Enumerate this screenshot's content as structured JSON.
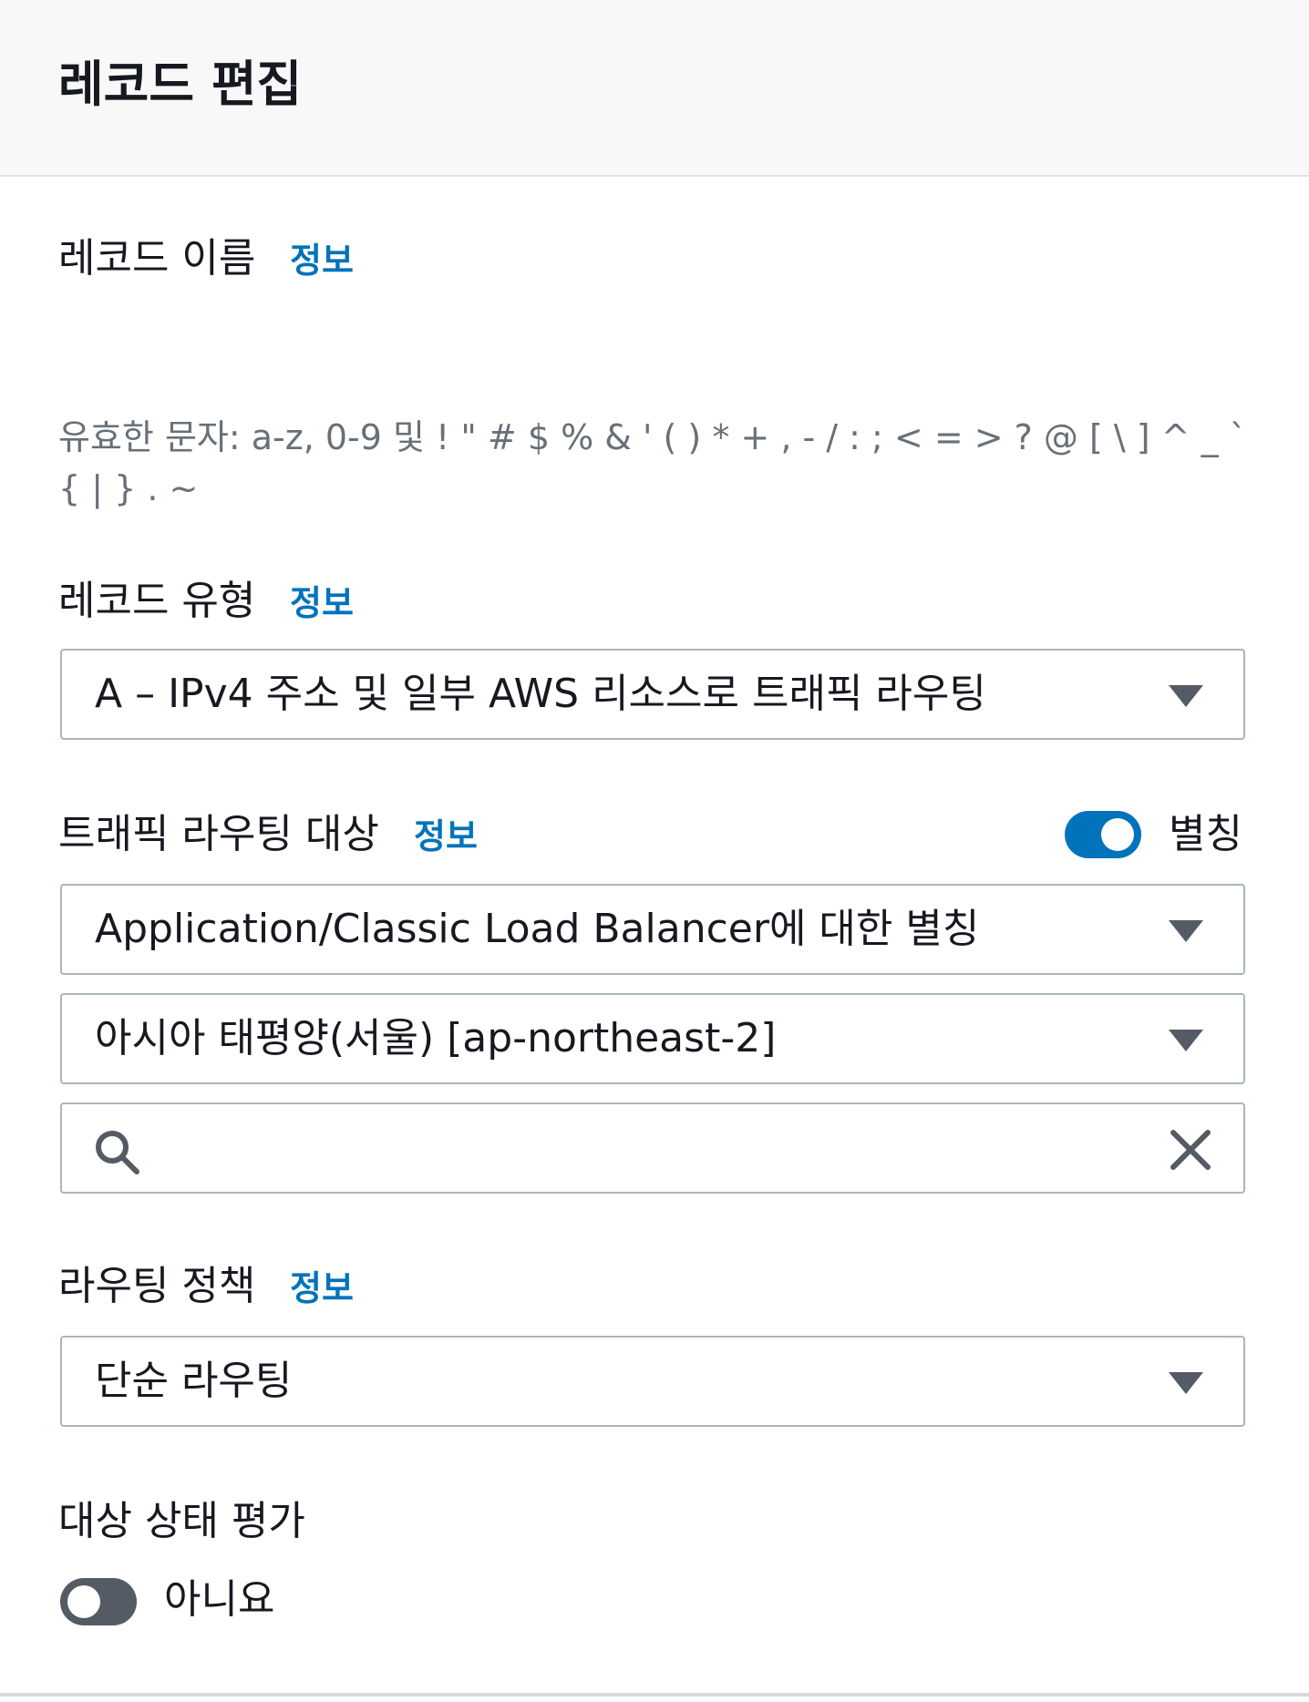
{
  "header": {
    "title": "레코드 편집"
  },
  "record_name": {
    "label": "레코드 이름",
    "info": "정보",
    "hint": "유효한 문자: a-z, 0-9 및 ! \" # $ % & ' ( ) * + , - / : ; < = > ? @ [ \\ ] ^ _ ` { | } . ~"
  },
  "record_type": {
    "label": "레코드 유형",
    "info": "정보",
    "selected": "A – IPv4 주소 및 일부 AWS 리소스로 트래픽 라우팅"
  },
  "traffic_target": {
    "label": "트래픽 라우팅 대상",
    "info": "정보",
    "alias_toggle": {
      "label": "별칭",
      "on": true
    },
    "endpoint_selected": "Application/Classic Load Balancer에 대한 별칭",
    "region_selected": "아시아 태평양(서울) [ap-northeast-2]",
    "search": {
      "value": "",
      "placeholder": ""
    },
    "icons": [
      "search-icon",
      "close-icon"
    ]
  },
  "routing_policy": {
    "label": "라우팅 정책",
    "info": "정보",
    "selected": "단순 라우팅"
  },
  "health_eval": {
    "label": "대상 상태 평가",
    "toggle": {
      "label": "아니요",
      "on": false
    }
  },
  "colors": {
    "accent": "#0073bb",
    "toggle_off": "#545b64",
    "border": "#aab7b8",
    "hint_text": "#687078",
    "header_bg": "#f8f8f8"
  }
}
